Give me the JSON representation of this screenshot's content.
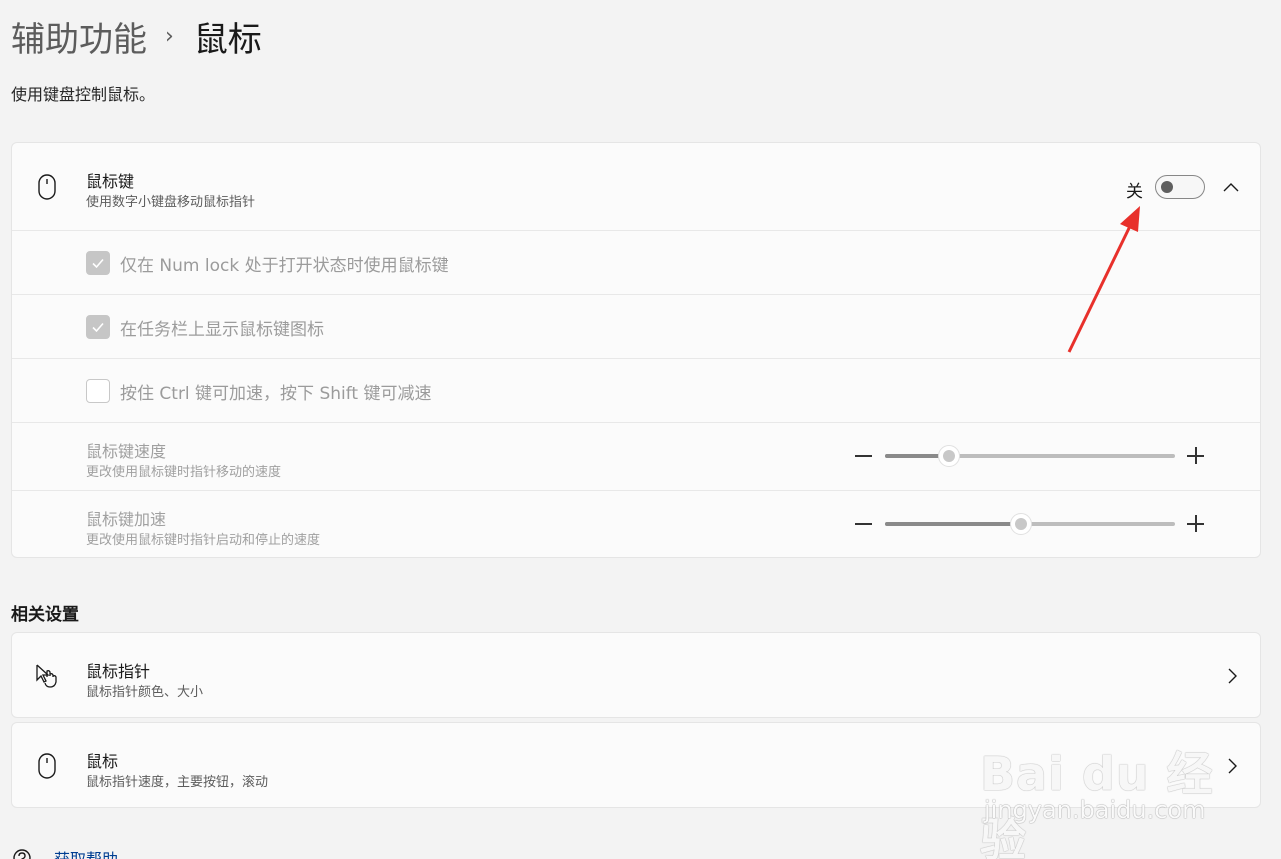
{
  "breadcrumb": {
    "parent": "辅助功能",
    "separator": "›",
    "current": "鼠标"
  },
  "page_description": "使用键盘控制鼠标。",
  "mouse_keys": {
    "title": "鼠标键",
    "subtitle": "使用数字小键盘移动鼠标指针",
    "toggle_state_label": "关",
    "toggle_on": false,
    "expanded": true,
    "icon": "mouse-icon",
    "options": [
      {
        "label": "仅在 Num lock 处于打开状态时使用鼠标键",
        "checked": true,
        "disabled": true
      },
      {
        "label": "在任务栏上显示鼠标键图标",
        "checked": true,
        "disabled": true
      },
      {
        "label": "按住 Ctrl 键可加速，按下 Shift 键可减速",
        "checked": false,
        "disabled": true
      }
    ],
    "sliders": [
      {
        "title": "鼠标键速度",
        "subtitle": "更改使用鼠标键时指针移动的速度",
        "value_fraction": 0.22
      },
      {
        "title": "鼠标键加速",
        "subtitle": "更改使用鼠标键时指针启动和停止的速度",
        "value_fraction": 0.47
      }
    ]
  },
  "related": {
    "heading": "相关设置",
    "items": [
      {
        "title": "鼠标指针",
        "subtitle": "鼠标指针颜色、大小",
        "icon": "pointer-hand-icon"
      },
      {
        "title": "鼠标",
        "subtitle": "鼠标指针速度，主要按钮，滚动",
        "icon": "mouse-icon"
      }
    ]
  },
  "help_link": {
    "label": "获取帮助",
    "icon": "help-icon"
  },
  "watermark": {
    "brand": "Bai du 经验",
    "url": "jingyan.baidu.com"
  },
  "colors": {
    "accent_link": "#003e92",
    "annotation_arrow": "#e8302b"
  }
}
